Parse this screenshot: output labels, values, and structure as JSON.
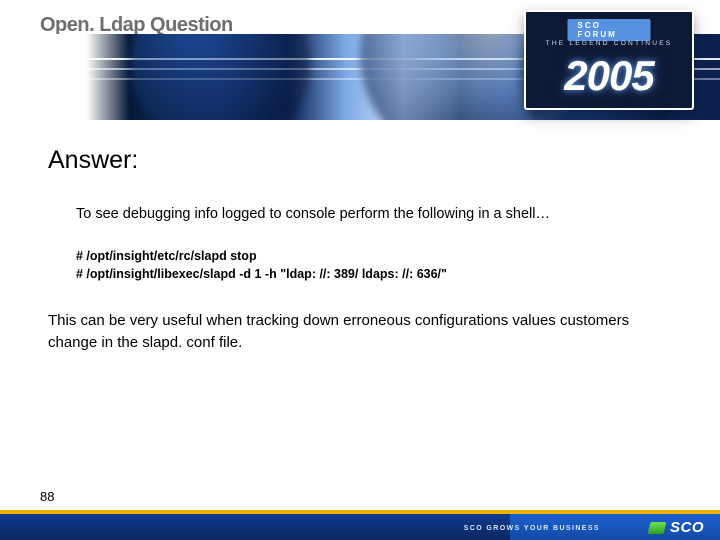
{
  "title": "Open. Ldap Question",
  "badge": {
    "tag": "SCO FORUM",
    "legend": "THE LEGEND CONTINUES",
    "year": "2005"
  },
  "content": {
    "answer_heading": "Answer:",
    "intro": "To see debugging info logged to console perform the following in a shell…",
    "code_line_1": "# /opt/insight/etc/rc/slapd stop",
    "code_line_2": "# /opt/insight/libexec/slapd -d 1 -h \"ldap: //: 389/ ldaps: //: 636/\"",
    "conclusion": "This can be very useful when tracking down erroneous configurations values customers change in the slapd. conf file."
  },
  "footer": {
    "tagline": "SCO GROWS YOUR BUSINESS",
    "logo_text": "SCO"
  },
  "page_number": "88"
}
